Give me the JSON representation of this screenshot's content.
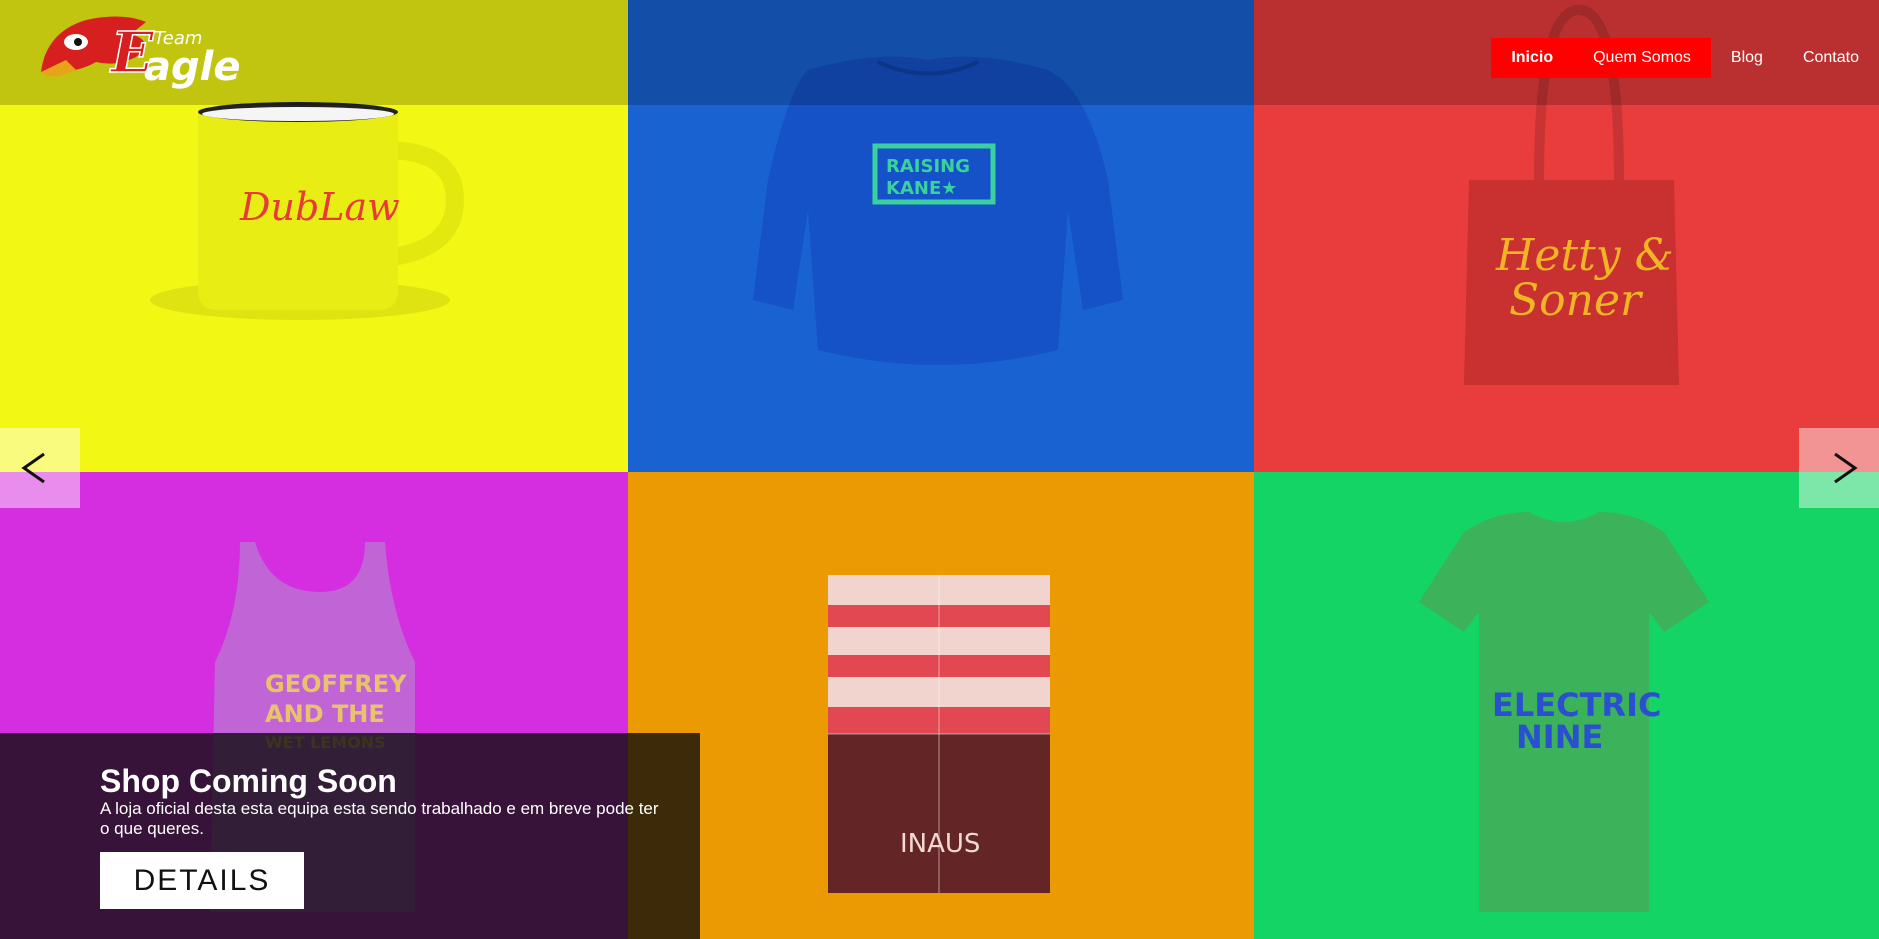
{
  "brand": {
    "logo_text_top": "Team",
    "logo_text_main": "agle",
    "logo_letter": "E"
  },
  "nav": {
    "items": [
      {
        "label": "Inicio",
        "active": true
      },
      {
        "label": "Quem Somos",
        "active": true
      },
      {
        "label": "Blog",
        "active": false
      },
      {
        "label": "Contato",
        "active": false
      }
    ]
  },
  "slider": {
    "tiles": [
      {
        "product": "mug",
        "print": "DubLaw",
        "color": "#f2f713"
      },
      {
        "product": "sweatshirt",
        "print": "RAISING KANE",
        "color": "#1862d2"
      },
      {
        "product": "tote-bag",
        "print": "Hetty & Soner",
        "color": "#e93c3c"
      },
      {
        "product": "tank-top",
        "print": "GEOFFREY AND THE WET LEMONS",
        "color": "#d52ee0"
      },
      {
        "product": "poster",
        "print": "INAUS",
        "color": "#ec9a04"
      },
      {
        "product": "t-shirt",
        "print": "ELECTRIC NINE",
        "color": "#13d464"
      }
    ],
    "prev_icon": "chevron-left-icon",
    "next_icon": "chevron-right-icon"
  },
  "caption": {
    "title": "Shop Coming Soon",
    "text": "A loja oficial desta esta equipa esta sendo trabalhado e em breve pode ter o que queres.",
    "button_label": "DETAILS"
  },
  "colors": {
    "nav_active": "#ff0000"
  }
}
